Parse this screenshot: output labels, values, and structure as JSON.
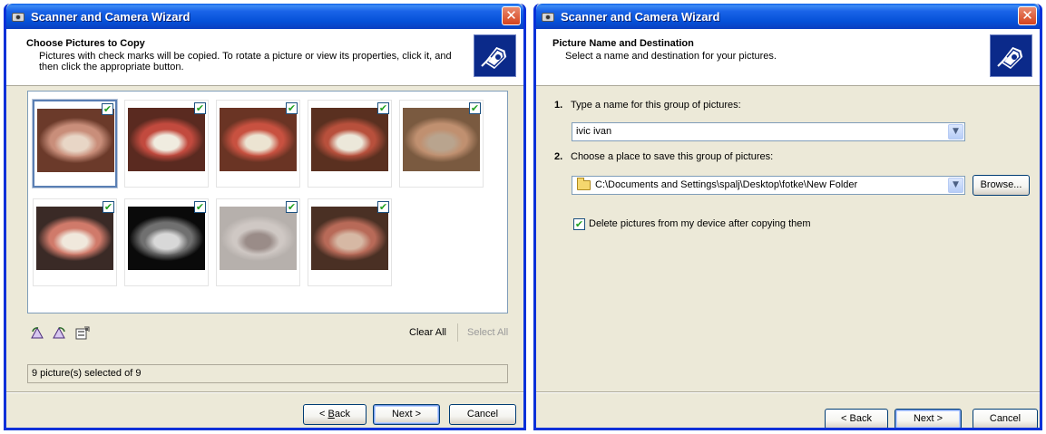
{
  "left_window": {
    "title": "Scanner and Camera Wizard",
    "close_glyph": "✕",
    "header_title": "Choose Pictures to Copy",
    "header_subtitle": "Pictures with check marks will be copied. To rotate a picture or view its properties, click it, and then click the appropriate button.",
    "thumbnails": [
      {
        "label": "photo-1",
        "checked": true,
        "selected": true,
        "colors": [
          "#6b3a2a",
          "#c98e7a",
          "#e8d6c6"
        ]
      },
      {
        "label": "photo-2",
        "checked": true,
        "selected": false,
        "colors": [
          "#5a2a20",
          "#c24a3e",
          "#f0ece0"
        ]
      },
      {
        "label": "photo-3",
        "checked": true,
        "selected": false,
        "colors": [
          "#6a3424",
          "#c85140",
          "#ece4d2"
        ]
      },
      {
        "label": "photo-4",
        "checked": true,
        "selected": false,
        "colors": [
          "#5a3020",
          "#b8503c",
          "#ece8da"
        ]
      },
      {
        "label": "photo-5",
        "checked": true,
        "selected": false,
        "colors": [
          "#7a5a40",
          "#c09070",
          "#b9a48e"
        ]
      },
      {
        "label": "photo-6",
        "checked": true,
        "selected": false,
        "colors": [
          "#3a2a26",
          "#d07a6a",
          "#f0e8dc"
        ]
      },
      {
        "label": "xray",
        "checked": true,
        "selected": false,
        "colors": [
          "#0a0a0a",
          "#707070",
          "#d8d8d8"
        ]
      },
      {
        "label": "document",
        "checked": true,
        "selected": false,
        "colors": [
          "#b6b0ac",
          "#cfc8c4",
          "#9a8c88"
        ]
      },
      {
        "label": "photo-9",
        "checked": true,
        "selected": false,
        "colors": [
          "#4a3024",
          "#b86a58",
          "#d6b8a4"
        ]
      }
    ],
    "check_glyph": "✔",
    "tool_icons": [
      "rotate-left-icon",
      "rotate-right-icon",
      "properties-icon"
    ],
    "clear_all": "Clear All",
    "select_all": "Select All",
    "status": "9 picture(s) selected of 9",
    "back": "< Back",
    "next": "Next >",
    "cancel": "Cancel"
  },
  "right_window": {
    "title": "Scanner and Camera Wizard",
    "close_glyph": "✕",
    "header_title": "Picture Name and Destination",
    "header_subtitle": "Select a name and destination for your pictures.",
    "step1_num": "1.",
    "step1_text": "Type a name for this group of pictures:",
    "name_value": "ivic ivan",
    "step2_num": "2.",
    "step2_text": "Choose a place to save this group of pictures:",
    "folder_value": "C:\\Documents and Settings\\spalj\\Desktop\\fotke\\New Folder",
    "browse": "Browse...",
    "delete_checkbox_label": "Delete pictures from my device after copying them",
    "delete_checked": true,
    "back": "< Back",
    "next": "Next >",
    "cancel": "Cancel"
  },
  "combo_arrow_glyph": "▼"
}
